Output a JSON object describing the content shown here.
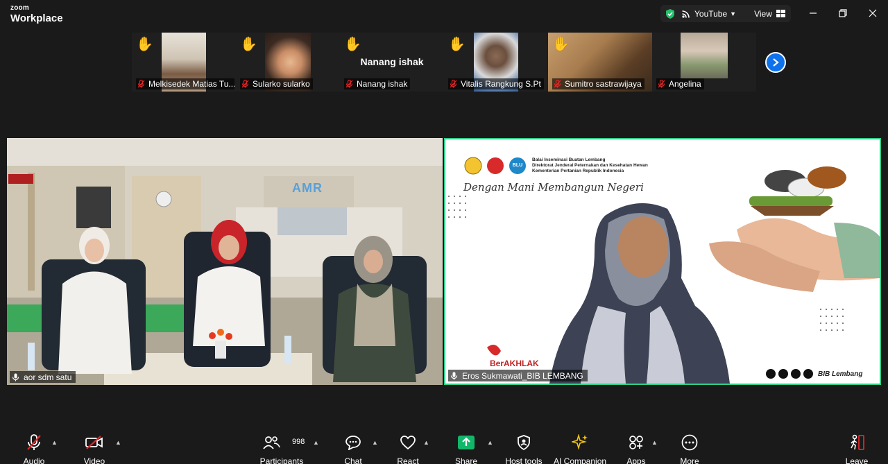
{
  "app": {
    "brand_small": "zoom",
    "brand_large": "Workplace"
  },
  "status": {
    "stream_label": "YouTube",
    "view_label": "View"
  },
  "colors": {
    "accent": "#0e72ed",
    "active_speaker": "#2fd08a",
    "raise_hand": "#f5c518",
    "muted": "#e02828",
    "share": "#12b76a"
  },
  "participants": [
    {
      "name": "Melkisedek Matias Tu...",
      "hand_raised": true,
      "muted": true
    },
    {
      "name": "Sularko sularko",
      "hand_raised": true,
      "muted": true
    },
    {
      "name": "Nanang ishak",
      "hand_raised": true,
      "muted": true,
      "center_name": "Nanang ishak"
    },
    {
      "name": "Vitalis Rangkung S.Pt",
      "hand_raised": true,
      "muted": true
    },
    {
      "name": "Sumitro sastrawijaya",
      "hand_raised": true,
      "muted": true
    },
    {
      "name": "Angelina",
      "hand_raised": false,
      "muted": true
    }
  ],
  "main_videos": [
    {
      "name": "aor sdm satu",
      "sign_text": "AMR"
    },
    {
      "name": "Eros Sukmawati_BIB LEMBANG",
      "bg_header_lines": [
        "Balai Inseminasi Buatan Lembang",
        "Direktorat Jenderal Peternakan dan Kesehatan Hewan",
        "Kementerian Pertanian Republik Indonesia"
      ],
      "blu_badge": "BLU",
      "slogan": "Dengan Mani Membangun Negeri",
      "footer_brand": "BerAKHLAK",
      "social_handle": "BIB Lembang"
    }
  ],
  "toolbar": {
    "audio": "Audio",
    "video": "Video",
    "participants": "Participants",
    "participants_count": "998",
    "chat": "Chat",
    "react": "React",
    "share": "Share",
    "host_tools": "Host tools",
    "ai_companion": "AI Companion",
    "apps": "Apps",
    "more": "More",
    "leave": "Leave"
  }
}
